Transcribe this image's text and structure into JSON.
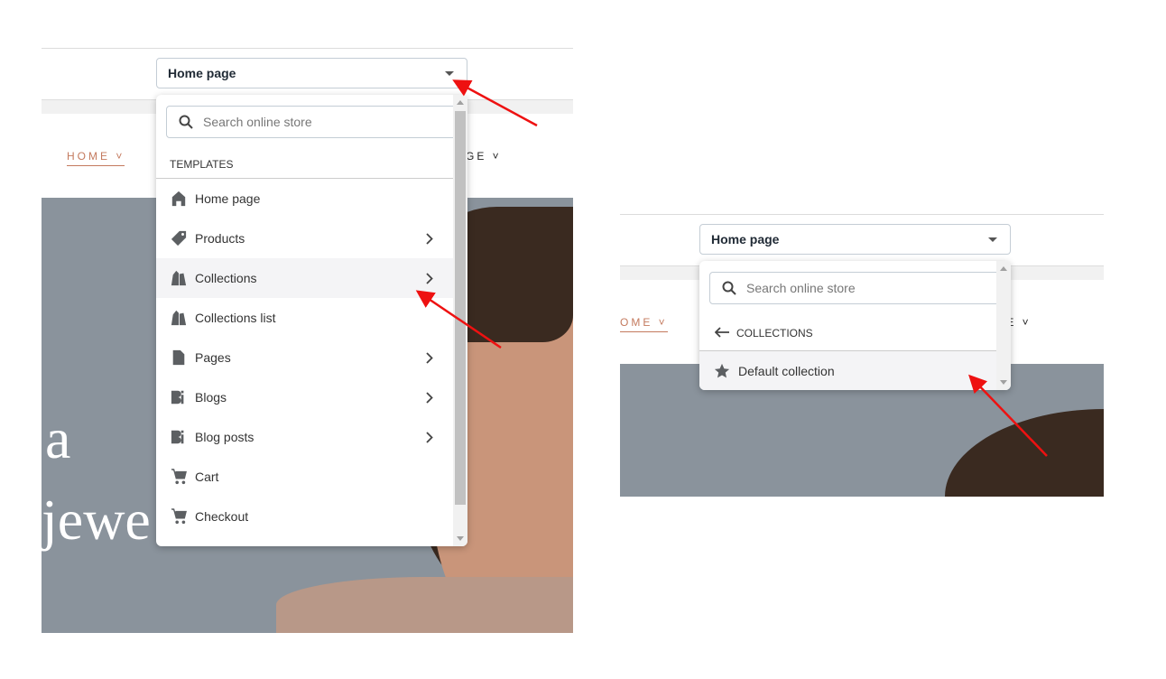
{
  "left": {
    "select_value": "Home page",
    "nav": [
      "HOME",
      "GE"
    ],
    "hero_text": [
      "a",
      "jewe"
    ],
    "search_placeholder": "Search online store",
    "section": "TEMPLATES",
    "items": [
      {
        "label": "Home page",
        "icon": "home-icon",
        "chevron": false
      },
      {
        "label": "Products",
        "icon": "tag-icon",
        "chevron": true
      },
      {
        "label": "Collections",
        "icon": "collection-icon",
        "chevron": true,
        "highlighted": true
      },
      {
        "label": "Collections list",
        "icon": "collection-icon",
        "chevron": false
      },
      {
        "label": "Pages",
        "icon": "page-icon",
        "chevron": true
      },
      {
        "label": "Blogs",
        "icon": "blog-icon",
        "chevron": true
      },
      {
        "label": "Blog posts",
        "icon": "blog-icon",
        "chevron": true
      },
      {
        "label": "Cart",
        "icon": "cart-icon",
        "chevron": false
      },
      {
        "label": "Checkout",
        "icon": "cart-icon",
        "chevron": false
      }
    ]
  },
  "right": {
    "select_value": "Home page",
    "nav": [
      "OME",
      "GE"
    ],
    "search_placeholder": "Search online store",
    "section": "COLLECTIONS",
    "items": [
      {
        "label": "Default collection",
        "icon": "star-icon",
        "highlighted": true
      }
    ]
  },
  "colors": {
    "annotation_arrow": "#ee1111",
    "nav_active": "#c47a5e",
    "icon": "#5c5f62"
  }
}
